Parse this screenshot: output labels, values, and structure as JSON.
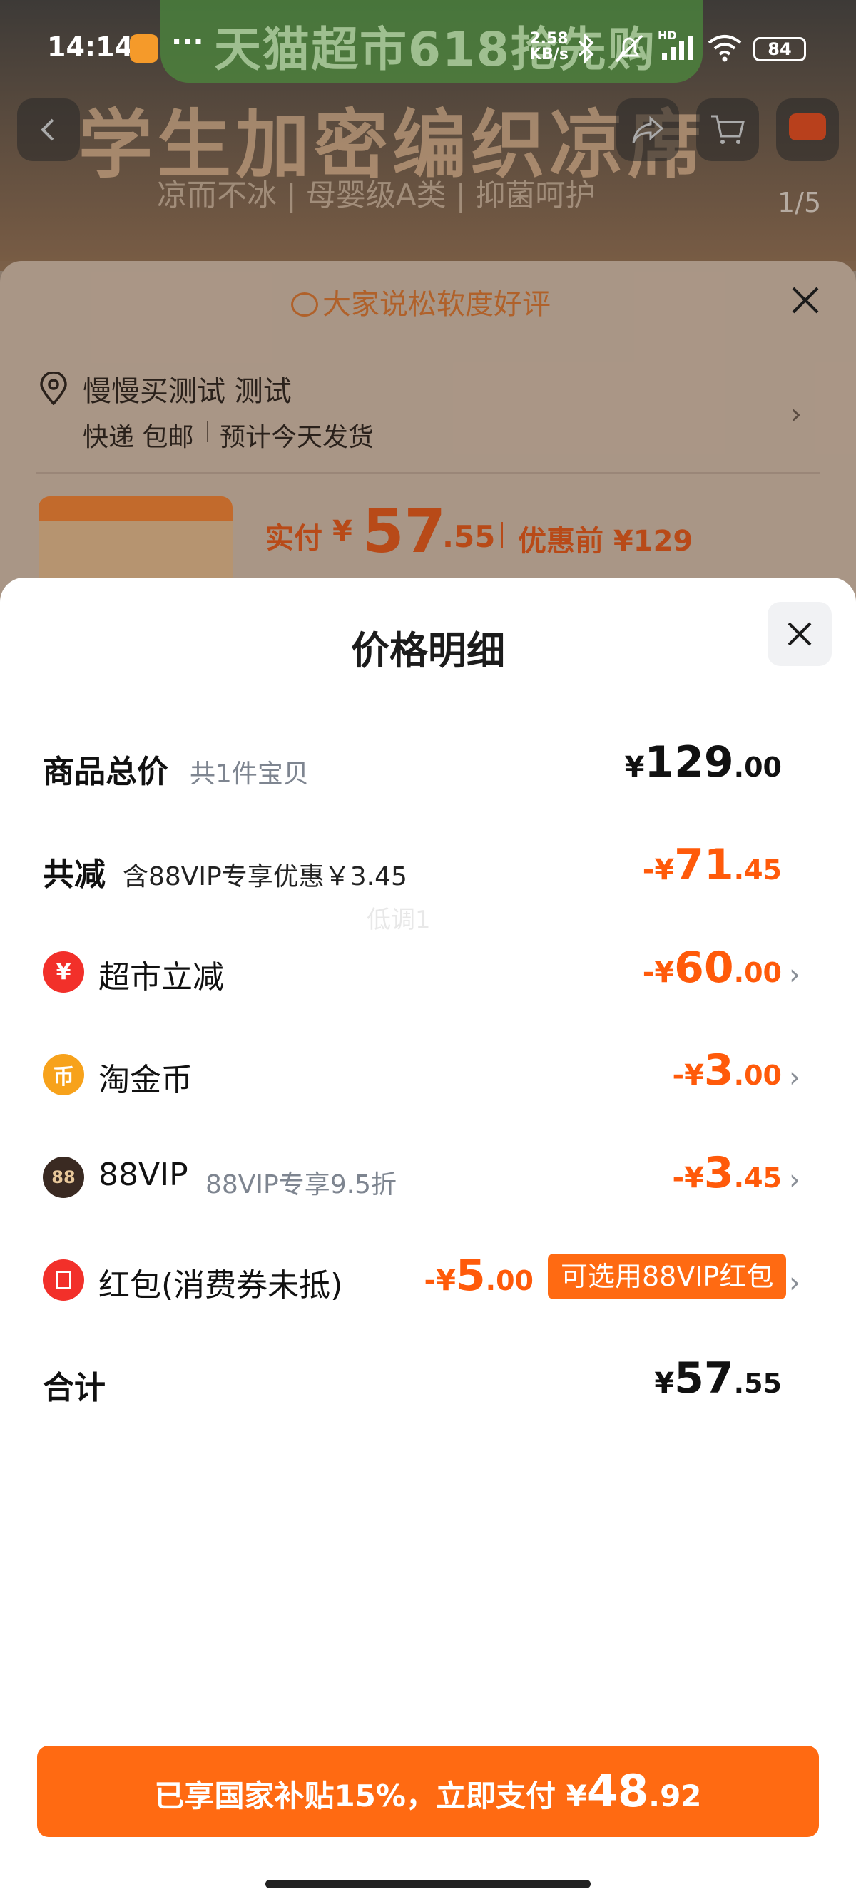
{
  "status_bar": {
    "time": "14:14",
    "more": "···",
    "speed_value": "2.58",
    "speed_unit": "KB/s",
    "network": "HD",
    "battery": "84"
  },
  "background_page": {
    "banner": "天猫超市618抢先购",
    "hero_title": "学生加密编织凉席",
    "hero_subtitle": "凉而不冰 | 母婴级A类 | 抑菌呵护",
    "image_counter": "1/5",
    "review_hint": "大家说松软度好评",
    "address_name": "慢慢买测试 测试",
    "shipping": "快递 包邮",
    "eta": "预计今天发货",
    "pay_label": "实付",
    "pay_yen": "¥",
    "pay_int": "57",
    "pay_dec": ".55",
    "pay_before": "优惠前 ¥129"
  },
  "sheet": {
    "title": "价格明细",
    "watermark": "低调1",
    "total": {
      "label": "商品总价",
      "sub": "共1件宝贝",
      "yen": "¥",
      "int": "129",
      "dec": ".00"
    },
    "reduce": {
      "label": "共减",
      "sub": "含88VIP专享优惠￥3.45",
      "prefix": "-¥",
      "int": "71",
      "dec": ".45"
    },
    "items": [
      {
        "label": "超市立减",
        "sub": "",
        "prefix": "-¥",
        "int": "60",
        "dec": ".00",
        "icon": "yuan-coupon-icon",
        "icon_glyph": "¥",
        "color": "#f2302a"
      },
      {
        "label": "淘金币",
        "sub": "",
        "prefix": "-¥",
        "int": "3",
        "dec": ".00",
        "icon": "gold-coin-icon",
        "icon_glyph": "币",
        "color": "#f7a21b"
      },
      {
        "label": "88VIP",
        "sub": "88VIP专享9.5折",
        "prefix": "-¥",
        "int": "3",
        "dec": ".45",
        "icon": "vip-88-icon",
        "icon_glyph": "88",
        "color": "#3a2a22"
      },
      {
        "label": "红包(消费券未抵)",
        "sub": "",
        "prefix": "-¥",
        "int": "5",
        "dec": ".00",
        "icon": "red-envelope-icon",
        "icon_glyph": "",
        "color": "#f2302a",
        "tag": "可选用88VIP红包"
      }
    ],
    "sum": {
      "label": "合计",
      "yen": "¥",
      "int": "57",
      "dec": ".55"
    }
  },
  "pay_button": {
    "text": "已享国家补贴15%，立即支付 ¥",
    "int": "48",
    "dec": ".92"
  },
  "colors": {
    "accent": "#ff6a12",
    "discount": "#ff5a0a"
  }
}
